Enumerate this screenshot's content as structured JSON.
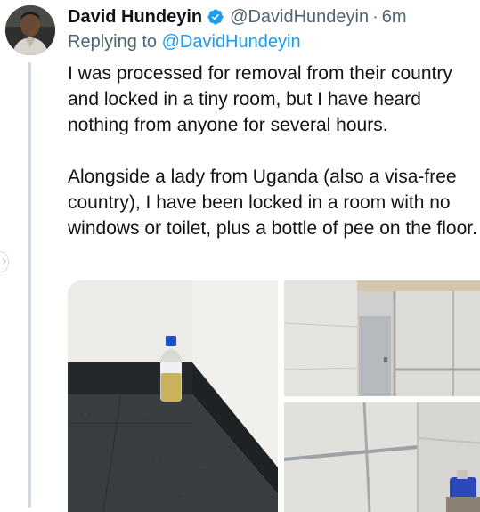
{
  "tweet": {
    "author_name": "David Hundeyin",
    "author_handle": "@DavidHundeyin",
    "separator": "·",
    "time": "6m",
    "replying_prefix": "Replying to",
    "replying_to": "@DavidHundeyin",
    "text_paragraphs": [
      "I was processed for removal from their country and locked in a tiny room, but I have heard nothing from anyone for several hours.",
      "Alongside a lady from Uganda (also a visa-free country), I have been locked in a room with no windows or toilet, plus a bottle of pee on the floor."
    ]
  },
  "icons": {
    "verified": "verified-badge-icon",
    "side": "chevron-right-icon"
  },
  "colors": {
    "primary_text": "#0f1419",
    "secondary_text": "#536471",
    "link": "#1d9bf0",
    "thread_line": "#cfd9de"
  },
  "media": {
    "photo_count": 3
  }
}
